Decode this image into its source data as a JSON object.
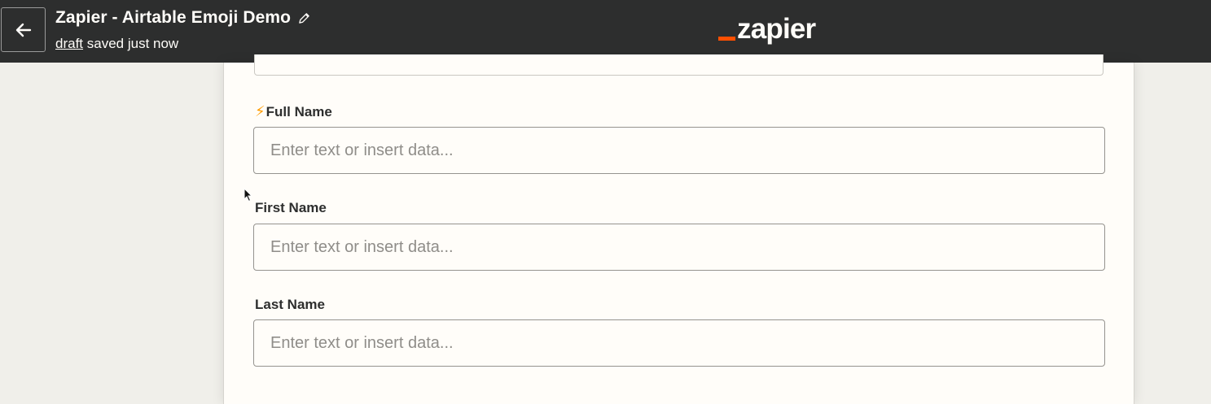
{
  "header": {
    "title": "Zapier - Airtable Emoji Demo",
    "draft_link": "draft",
    "status_text": " saved just now",
    "logo_text": "zapier",
    "back_icon": "arrow-left-icon",
    "edit_icon": "pencil-icon"
  },
  "colors": {
    "topbar": "#2d2e2e",
    "brand_accent": "#ff4f00",
    "panel": "#fffdf9",
    "page_background": "#f0efea",
    "bolt": "#ff9d00"
  },
  "form": {
    "fields": [
      {
        "label": "Full Name",
        "label_icon": "lightning-bolt-icon",
        "label_icon_glyph": "⚡",
        "value": "",
        "placeholder": "Enter text or insert data..."
      },
      {
        "label": "First Name",
        "value": "",
        "placeholder": "Enter text or insert data..."
      },
      {
        "label": "Last Name",
        "value": "",
        "placeholder": "Enter text or insert data..."
      }
    ]
  }
}
